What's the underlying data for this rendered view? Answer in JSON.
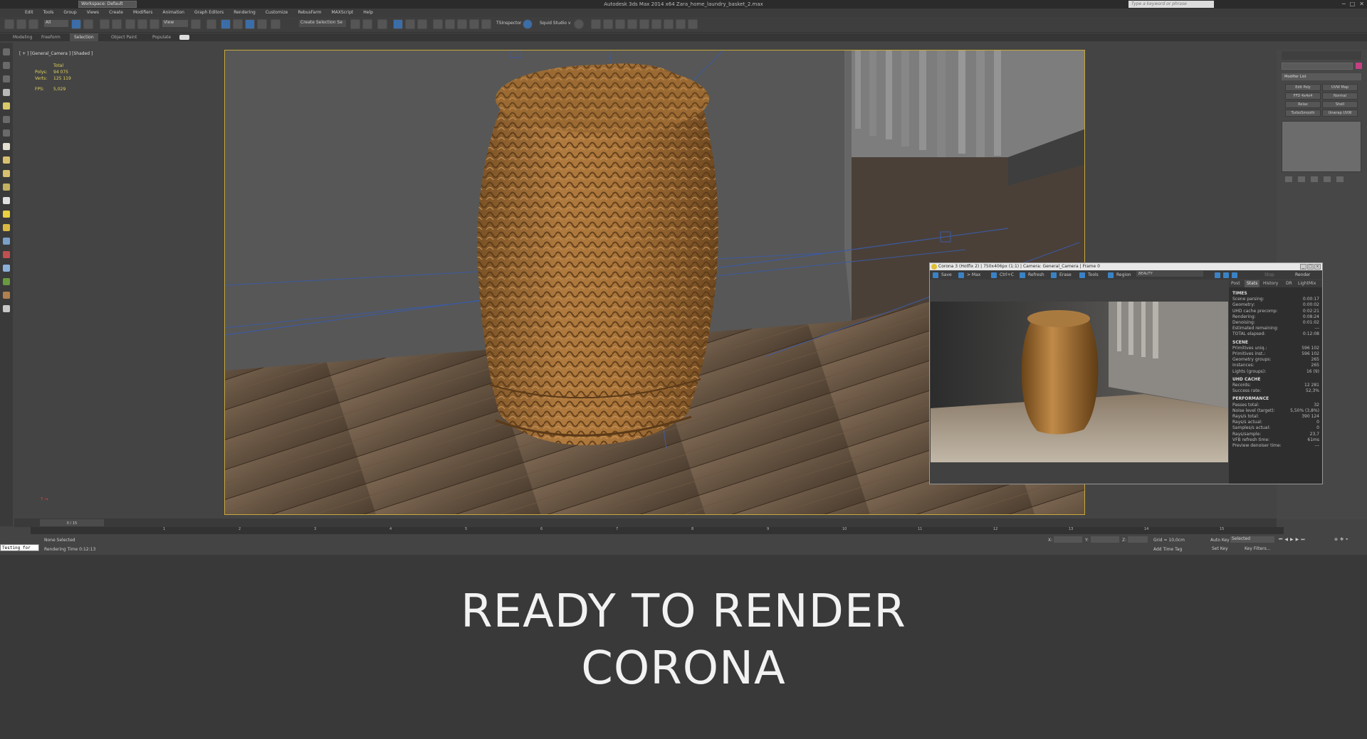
{
  "window": {
    "title": "Autodesk 3ds Max  2014 x64     Zara_home_laundry_basket_2.max",
    "workspace": "Workspace: Default",
    "search_placeholder": "Type a keyword or phrase"
  },
  "menu": [
    "Edit",
    "Tools",
    "Group",
    "Views",
    "Create",
    "Modifiers",
    "Animation",
    "Graph Editors",
    "Rendering",
    "Customize",
    "RebusFarm",
    "MAXScript",
    "Help"
  ],
  "toolbar": {
    "filter": "All",
    "view": "View",
    "selection_set": "Create Selection Se",
    "tsinspector": "TSInspector",
    "squid": "Squid Studio v"
  },
  "ribbon": {
    "tabs": [
      "Modeling",
      "Freeform",
      "Selection",
      "Object Paint",
      "Populate"
    ],
    "active": "Selection"
  },
  "viewport": {
    "label": "[ + ] [General_Camera ] [Shaded ]",
    "stats_header": "Total",
    "stats": [
      {
        "label": "Polys:",
        "value": "94 075"
      },
      {
        "label": "Verts:",
        "value": "125 119"
      }
    ],
    "fps_label": "FPS:",
    "fps_value": "5,029"
  },
  "command_panel": {
    "modifier_list": "Modifier List",
    "buttons": [
      "Edit Poly",
      "UVW Map",
      "FFD 4x4x4",
      "Normal",
      "Relax",
      "Shell",
      "TurboSmooth",
      "Unwrap UVW"
    ]
  },
  "vfb": {
    "title": "Corona 3 (Hotfix 2) | 750x406px (1:1) | Camera: General_Camera | Frame 0",
    "tools": [
      "Save",
      "> Max",
      "Ctrl+C",
      "Refresh",
      "Erase",
      "Tools",
      "Region"
    ],
    "pass": "BEAUTY",
    "stop": "Stop",
    "render": "Render",
    "tabs": [
      "Post",
      "Stats",
      "History",
      "DR",
      "LightMix"
    ],
    "active_tab": "Stats",
    "sections": [
      {
        "title": "TIMES",
        "rows": [
          {
            "k": "Scene parsing:",
            "v": "0:00:17"
          },
          {
            "k": "Geometry:",
            "v": "0:00:02"
          },
          {
            "k": "UHD cache precomp:",
            "v": "0:02:21"
          },
          {
            "k": "Rendering:",
            "v": "0:08:24"
          },
          {
            "k": "Denoising:",
            "v": "0:01:02"
          },
          {
            "k": "Estimated remaining:",
            "v": "---"
          },
          {
            "k": "TOTAL elapsed:",
            "v": "0:12:08"
          }
        ]
      },
      {
        "title": "SCENE",
        "rows": [
          {
            "k": "Primitives uniq.:",
            "v": "596 102"
          },
          {
            "k": "Primitives inst.:",
            "v": "596 102"
          },
          {
            "k": "Geometry groups:",
            "v": "265"
          },
          {
            "k": "Instances:",
            "v": "265"
          },
          {
            "k": "Lights (groups):",
            "v": "16 (9)"
          }
        ]
      },
      {
        "title": "UHD CACHE",
        "rows": [
          {
            "k": "Records:",
            "v": "12 281"
          },
          {
            "k": "Success rate:",
            "v": "52,3%"
          }
        ]
      },
      {
        "title": "PERFORMANCE",
        "rows": [
          {
            "k": "Passes total:",
            "v": "32"
          },
          {
            "k": "Noise level (target):",
            "v": "5,50% (3,8%)"
          },
          {
            "k": "Rays/s total:",
            "v": "390 124"
          },
          {
            "k": "Rays/s actual:",
            "v": "0"
          },
          {
            "k": "Samples/s actual:",
            "v": "0"
          },
          {
            "k": "Rays/sample:",
            "v": "23,7"
          },
          {
            "k": "VFB refresh time:",
            "v": "61ms"
          },
          {
            "k": "Preview denoiser time:",
            "v": "---"
          }
        ]
      }
    ]
  },
  "timeline": {
    "frame": "0 / 15",
    "ticks": [
      "1",
      "2",
      "3",
      "4",
      "5",
      "6",
      "7",
      "8",
      "9",
      "10",
      "11",
      "12",
      "13",
      "14",
      "15"
    ]
  },
  "status": {
    "listener": "Testing for",
    "selection": "None Selected",
    "render_time": "Rendering Time  0:12:13",
    "grid": "Grid = 10,0cm",
    "add_time_tag": "Add Time Tag",
    "auto_key": "Auto Key",
    "set_key": "Set Key",
    "selected": "Selected",
    "key_filters": "Key Filters...",
    "x": "X:",
    "y": "Y:",
    "z": "Z:"
  },
  "caption": {
    "line1": "READY TO RENDER",
    "line2": "CORONA"
  }
}
